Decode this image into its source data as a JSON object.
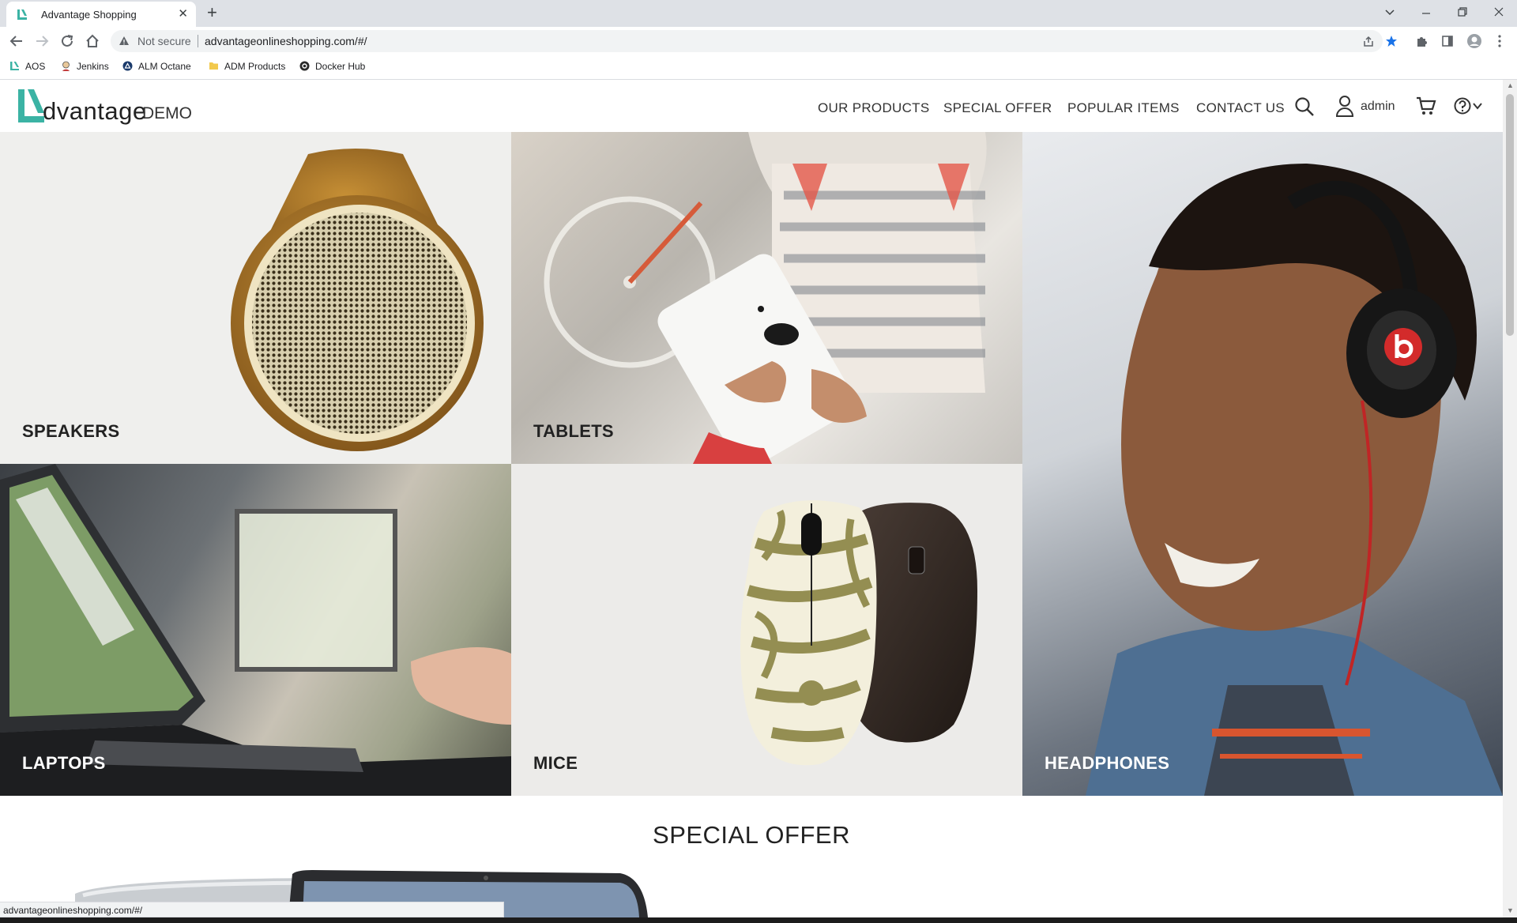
{
  "browser": {
    "tab_title": "Advantage Shopping",
    "tab_close": "✕",
    "new_tab": "+",
    "security_text": "Not secure",
    "url": "advantageonlineshopping.com/#/",
    "status_url": "advantageonlineshopping.com/#/",
    "bookmarks": [
      {
        "label": "AOS",
        "icon": "aos-logo-icon",
        "color": "#3bb3a4"
      },
      {
        "label": "Jenkins",
        "icon": "jenkins-icon",
        "color": "#c9a25e"
      },
      {
        "label": "ALM Octane",
        "icon": "octane-icon",
        "color": "#1a3a6b"
      },
      {
        "label": "ADM Products",
        "icon": "folder-icon",
        "color": "#f2c94c"
      },
      {
        "label": "Docker Hub",
        "icon": "docker-icon",
        "color": "#2a2a2a"
      }
    ]
  },
  "site": {
    "brand_accent": "#3bb3a4",
    "logo_text": "dvantage",
    "logo_suffix": "DEMO",
    "nav": [
      "OUR PRODUCTS",
      "SPECIAL OFFER",
      "POPULAR ITEMS",
      "CONTACT US"
    ],
    "user": "admin",
    "categories": [
      {
        "label": "SPEAKERS",
        "color": "#222222"
      },
      {
        "label": "TABLETS",
        "color": "#222222"
      },
      {
        "label": "HEADPHONES",
        "color": "#ffffff"
      },
      {
        "label": "LAPTOPS",
        "color": "#ffffff"
      },
      {
        "label": "MICE",
        "color": "#222222"
      }
    ],
    "special_offer_title": "SPECIAL OFFER"
  }
}
